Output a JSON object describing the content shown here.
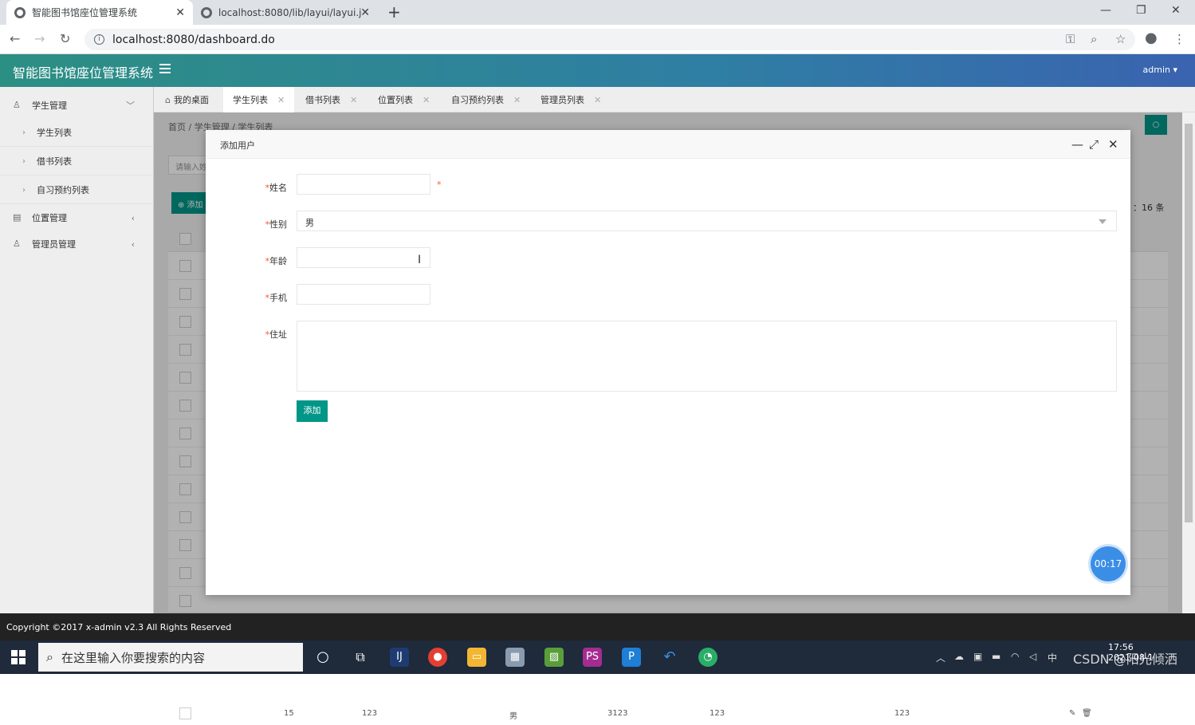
{
  "browser": {
    "tabs": [
      {
        "title": "智能图书馆座位管理系统"
      },
      {
        "title": "localhost:8080/lib/layui/layui.j"
      }
    ],
    "url": "localhost:8080/dashboard.do"
  },
  "header": {
    "app_title": "智能图书馆座位管理系统",
    "user": "admin"
  },
  "sidebar": {
    "groups": [
      {
        "label": "学生管理",
        "icon": "user-icon"
      },
      {
        "label": "位置管理",
        "icon": "document-icon"
      },
      {
        "label": "管理员管理",
        "icon": "user-icon"
      }
    ],
    "items": [
      "学生列表",
      "借书列表",
      "自习预约列表"
    ]
  },
  "content_tabs": [
    "我的桌面",
    "学生列表",
    "借书列表",
    "位置列表",
    "自习预约列表",
    "管理员列表"
  ],
  "page": {
    "breadcrumb": "首页 / 学生管理 / 学生列表",
    "search_placeholder": "请输入姓",
    "add_label": "⊕ 添加",
    "count": "：16 条",
    "last_row": [
      "15",
      "123",
      "男",
      "3123",
      "123",
      "123"
    ]
  },
  "modal": {
    "title": "添加用户",
    "fields": {
      "name_label": "姓名",
      "gender_label": "性别",
      "gender_value": "男",
      "age_label": "年龄",
      "phone_label": "手机",
      "address_label": "住址"
    },
    "submit": "添加"
  },
  "timer": "00:17",
  "footer": "Copyright ©2017 x-admin v2.3 All Rights Reserved",
  "taskbar": {
    "search_placeholder": "在这里输入你要搜索的内容",
    "time": "17:56",
    "date": "2021-08-1",
    "ime": "中"
  },
  "watermark": "CSDN @阳光倾洒",
  "colors": {
    "accent": "#009688",
    "header_start": "#2c8f83",
    "header_end": "#3a63b0",
    "required": "#ff5722"
  }
}
